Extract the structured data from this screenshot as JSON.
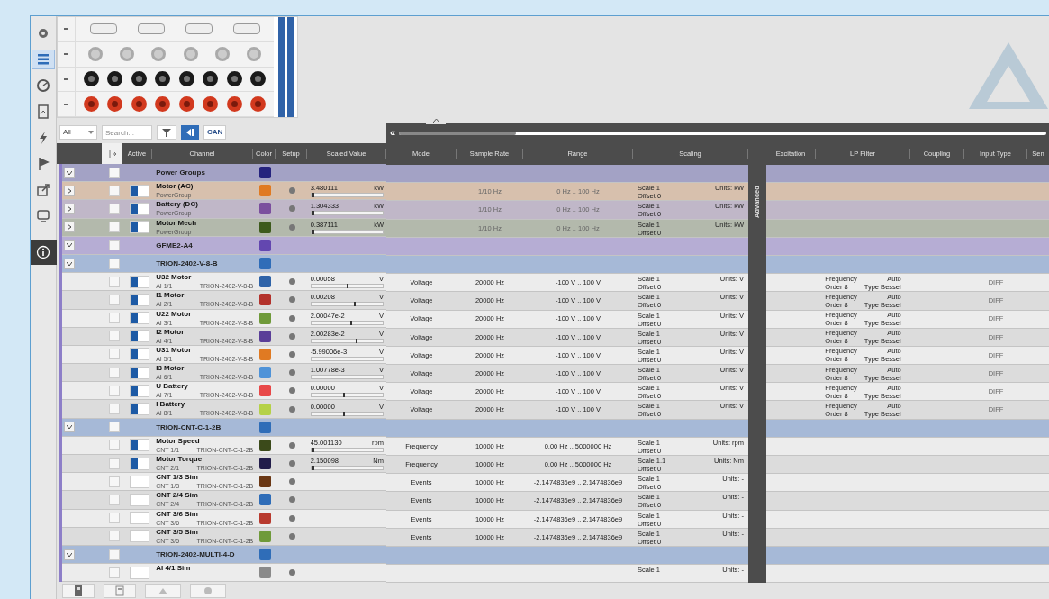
{
  "sidebar": {
    "items": [
      {
        "kind": "gear",
        "selected": false
      },
      {
        "kind": "list",
        "selected": true
      },
      {
        "kind": "gauge",
        "selected": false
      },
      {
        "kind": "report",
        "selected": false
      },
      {
        "kind": "bolt",
        "selected": false
      },
      {
        "kind": "flag",
        "selected": false
      },
      {
        "kind": "export",
        "selected": false
      },
      {
        "kind": "monitor",
        "selected": false
      },
      {
        "kind": "info",
        "selected": false
      }
    ]
  },
  "toolbar": {
    "filter": "All",
    "search_placeholder": "Search...",
    "view_toggle_on": true,
    "can_label": "CAN"
  },
  "left_columns": [
    "Active",
    "Channel",
    "Color",
    "Setup",
    "Scaled Value"
  ],
  "right_panel": {
    "collapse": "«",
    "columns": [
      "Mode",
      "Sample Rate",
      "Range",
      "Scaling"
    ],
    "advanced_label": "Advanced",
    "columns_2": [
      "Excitation",
      "LP Filter",
      "Coupling",
      "Input Type",
      "Sen"
    ]
  },
  "rows": [
    {
      "kind": "group",
      "expanded": true,
      "checked": false,
      "name": "Power Groups",
      "color": "#25237e"
    },
    {
      "kind": "power",
      "expanded": false,
      "checked": false,
      "active": true,
      "name": "Motor (AC)",
      "sub": "PowerGroup",
      "color": "#e07a22",
      "value": "3.480111",
      "unit": "kW",
      "level": 0.02,
      "sample_rate": "1/10 Hz",
      "range": "0 Hz .. 100 Hz",
      "scale": "Scale 1",
      "offset": "Offset 0",
      "units": "Units: kW"
    },
    {
      "kind": "power",
      "expanded": false,
      "checked": false,
      "active": true,
      "name": "Battery (DC)",
      "sub": "PowerGroup",
      "color": "#7b4f9e",
      "value": "1.304333",
      "unit": "kW",
      "level": 0.02,
      "sample_rate": "1/10 Hz",
      "range": "0 Hz .. 100 Hz",
      "scale": "Scale 1",
      "offset": "Offset 0",
      "units": "Units: kW"
    },
    {
      "kind": "power",
      "expanded": false,
      "checked": false,
      "active": true,
      "name": "Motor Mech",
      "sub": "PowerGroup",
      "color": "#3d5a1c",
      "value": "0.387111",
      "unit": "kW",
      "level": 0.02,
      "sample_rate": "1/10 Hz",
      "range": "0 Hz .. 100 Hz",
      "scale": "Scale 1",
      "offset": "Offset 0",
      "units": "Units: kW"
    },
    {
      "kind": "group",
      "expanded": true,
      "checked": false,
      "name": "GFME2-A4",
      "color": "#6347b0"
    },
    {
      "kind": "group",
      "expanded": true,
      "checked": false,
      "name": "TRION-2402-V-8-B",
      "color": "#2f6db8"
    },
    {
      "kind": "channel",
      "checked": false,
      "active": true,
      "name": "U32 Motor",
      "sub": "AI 1/1",
      "device": "TRION-2402-V-8-B",
      "color": "#2f63a8",
      "value": "0.00058",
      "unit": "V",
      "level": 0.5,
      "mode": "Voltage",
      "sample_rate": "20000 Hz",
      "range": "-100 V .. 100 V",
      "scale": "Scale 1",
      "offset": "Offset 0",
      "units": "Units: V",
      "filter_a": "Frequency",
      "filter_b": "Order 8",
      "filter_c": "Auto",
      "filter_d": "Type Bessel",
      "input_type": "DIFF"
    },
    {
      "kind": "channel",
      "checked": false,
      "active": true,
      "name": "I1 Motor",
      "sub": "AI 2/1",
      "device": "TRION-2402-V-8-B",
      "color": "#b3322c",
      "value": "0.00208",
      "unit": "V",
      "level": 0.6,
      "mode": "Voltage",
      "sample_rate": "20000 Hz",
      "range": "-100 V .. 100 V",
      "scale": "Scale 1",
      "offset": "Offset 0",
      "units": "Units: V",
      "filter_a": "Frequency",
      "filter_b": "Order 8",
      "filter_c": "Auto",
      "filter_d": "Type Bessel",
      "input_type": "DIFF"
    },
    {
      "kind": "channel",
      "checked": false,
      "active": true,
      "name": "U22 Motor",
      "sub": "AI 3/1",
      "device": "TRION-2402-V-8-B",
      "color": "#6f9a3a",
      "value": "2.00047e-2",
      "unit": "V",
      "level": 0.55,
      "mode": "Voltage",
      "sample_rate": "20000 Hz",
      "range": "-100 V .. 100 V",
      "scale": "Scale 1",
      "offset": "Offset 0",
      "units": "Units: V",
      "filter_a": "Frequency",
      "filter_b": "Order 8",
      "filter_c": "Auto",
      "filter_d": "Type Bessel",
      "input_type": "DIFF"
    },
    {
      "kind": "channel",
      "checked": false,
      "active": true,
      "name": "I2 Motor",
      "sub": "AI 4/1",
      "device": "TRION-2402-V-8-B",
      "color": "#5a3e98",
      "value": "2.00283e-2",
      "unit": "V",
      "level": 0.62,
      "mode": "Voltage",
      "sample_rate": "20000 Hz",
      "range": "-100 V .. 100 V",
      "scale": "Scale 1",
      "offset": "Offset 0",
      "units": "Units: V",
      "filter_a": "Frequency",
      "filter_b": "Order 8",
      "filter_c": "Auto",
      "filter_d": "Type Bessel",
      "input_type": "DIFF"
    },
    {
      "kind": "channel",
      "checked": false,
      "active": true,
      "name": "U31 Motor",
      "sub": "AI 5/1",
      "device": "TRION-2402-V-8-B",
      "color": "#e07a22",
      "value": "-5.99006e-3",
      "unit": "V",
      "level": 0.25,
      "mode": "Voltage",
      "sample_rate": "20000 Hz",
      "range": "-100 V .. 100 V",
      "scale": "Scale 1",
      "offset": "Offset 0",
      "units": "Units: V",
      "filter_a": "Frequency",
      "filter_b": "Order 8",
      "filter_c": "Auto",
      "filter_d": "Type Bessel",
      "input_type": "DIFF"
    },
    {
      "kind": "channel",
      "checked": false,
      "active": true,
      "name": "I3 Motor",
      "sub": "AI 6/1",
      "device": "TRION-2402-V-8-B",
      "color": "#4f93d8",
      "value": "1.00778e-3",
      "unit": "V",
      "level": 0.63,
      "mode": "Voltage",
      "sample_rate": "20000 Hz",
      "range": "-100 V .. 100 V",
      "scale": "Scale 1",
      "offset": "Offset 0",
      "units": "Units: V",
      "filter_a": "Frequency",
      "filter_b": "Order 8",
      "filter_c": "Auto",
      "filter_d": "Type Bessel",
      "input_type": "DIFF"
    },
    {
      "kind": "channel",
      "checked": false,
      "active": true,
      "name": "U Battery",
      "sub": "AI 7/1",
      "device": "TRION-2402-V-8-B",
      "color": "#e84848",
      "value": "0.00000",
      "unit": "V",
      "level": 0.45,
      "mode": "Voltage",
      "sample_rate": "20000 Hz",
      "range": "-100 V .. 100 V",
      "scale": "Scale 1",
      "offset": "Offset 0",
      "units": "Units: V",
      "filter_a": "Frequency",
      "filter_b": "Order 8",
      "filter_c": "Auto",
      "filter_d": "Type Bessel",
      "input_type": "DIFF"
    },
    {
      "kind": "channel",
      "checked": false,
      "active": true,
      "name": "I Battery",
      "sub": "AI 8/1",
      "device": "TRION-2402-V-8-B",
      "color": "#b5d147",
      "value": "0.00000",
      "unit": "V",
      "level": 0.45,
      "mode": "Voltage",
      "sample_rate": "20000 Hz",
      "range": "-100 V .. 100 V",
      "scale": "Scale 1",
      "offset": "Offset 0",
      "units": "Units: V",
      "filter_a": "Frequency",
      "filter_b": "Order 8",
      "filter_c": "Auto",
      "filter_d": "Type Bessel",
      "input_type": "DIFF"
    },
    {
      "kind": "group",
      "expanded": true,
      "checked": false,
      "name": "TRION-CNT-C-1-2B",
      "color": "#2f6db8"
    },
    {
      "kind": "channel",
      "checked": false,
      "active": true,
      "name": "Motor Speed",
      "sub": "CNT 1/1",
      "device": "TRION-CNT-C-1-2B",
      "color": "#3b4a1a",
      "value": "45.001130",
      "unit": "rpm",
      "level": 0.02,
      "mode": "Frequency",
      "sample_rate": "10000 Hz",
      "range": "0.00 Hz .. 5000000 Hz",
      "scale": "Scale 1",
      "offset": "Offset 0",
      "units": "Units: rpm"
    },
    {
      "kind": "channel",
      "checked": false,
      "active": true,
      "name": "Motor Torque",
      "sub": "CNT 2/1",
      "device": "TRION-CNT-C-1-2B",
      "color": "#221d4a",
      "value": "2.150098",
      "unit": "Nm",
      "level": 0.02,
      "mode": "Frequency",
      "sample_rate": "10000 Hz",
      "range": "0.00 Hz .. 5000000 Hz",
      "scale": "Scale 1.1",
      "offset": "Offset 0",
      "units": "Units: Nm"
    },
    {
      "kind": "channel",
      "checked": false,
      "active": false,
      "name": "CNT 1/3 Sim",
      "sub": "CNT 1/3",
      "device": "TRION-CNT-C-1-2B",
      "color": "#6b3815",
      "mode": "Events",
      "sample_rate": "10000 Hz",
      "range": "-2.1474836e9 .. 2.1474836e9",
      "scale": "Scale 1",
      "offset": "Offset 0",
      "units": "Units: -"
    },
    {
      "kind": "channel",
      "checked": false,
      "active": false,
      "name": "CNT 2/4 Sim",
      "sub": "CNT 2/4",
      "device": "TRION-CNT-C-1-2B",
      "color": "#2f6db8",
      "mode": "Events",
      "sample_rate": "10000 Hz",
      "range": "-2.1474836e9 .. 2.1474836e9",
      "scale": "Scale 1",
      "offset": "Offset 0",
      "units": "Units: -"
    },
    {
      "kind": "channel",
      "checked": false,
      "active": false,
      "name": "CNT 3/6 Sim",
      "sub": "CNT 3/6",
      "device": "TRION-CNT-C-1-2B",
      "color": "#b83a2e",
      "mode": "Events",
      "sample_rate": "10000 Hz",
      "range": "-2.1474836e9 .. 2.1474836e9",
      "scale": "Scale 1",
      "offset": "Offset 0",
      "units": "Units: -"
    },
    {
      "kind": "channel",
      "checked": false,
      "active": false,
      "name": "CNT 3/5 Sim",
      "sub": "CNT 3/5",
      "device": "TRION-CNT-C-1-2B",
      "color": "#6f9a3a",
      "mode": "Events",
      "sample_rate": "10000 Hz",
      "range": "-2.1474836e9 .. 2.1474836e9",
      "scale": "Scale 1",
      "offset": "Offset 0",
      "units": "Units: -"
    },
    {
      "kind": "group",
      "expanded": true,
      "checked": false,
      "name": "TRION-2402-MULTI-4-D",
      "color": "#2f6db8"
    },
    {
      "kind": "channel",
      "checked": false,
      "active": false,
      "name": "AI 4/1 Sim",
      "color": "#8a8a8a",
      "scale": "Scale 1",
      "units": "Units: -"
    }
  ]
}
